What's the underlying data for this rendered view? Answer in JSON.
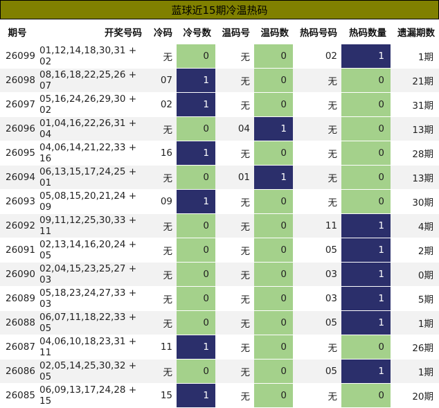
{
  "title": "蓝球近15期冷温热码",
  "headers": [
    "期号",
    "开奖号码",
    "冷码",
    "冷号数",
    "温码号",
    "温码数",
    "热码号码",
    "热码数量",
    "遗漏期数"
  ],
  "rows": [
    [
      "26099",
      "01,12,14,18,30,31 + 02",
      "无",
      "0",
      "无",
      "0",
      "02",
      "1",
      "1期"
    ],
    [
      "26098",
      "08,16,18,22,25,26 + 07",
      "07",
      "1",
      "无",
      "0",
      "无",
      "0",
      "21期"
    ],
    [
      "26097",
      "05,16,24,26,29,30 + 02",
      "02",
      "1",
      "无",
      "0",
      "无",
      "0",
      "31期"
    ],
    [
      "26096",
      "01,04,16,22,26,31 + 04",
      "无",
      "0",
      "04",
      "1",
      "无",
      "0",
      "13期"
    ],
    [
      "26095",
      "04,06,14,21,22,33 + 16",
      "16",
      "1",
      "无",
      "0",
      "无",
      "0",
      "28期"
    ],
    [
      "26094",
      "06,13,15,17,24,25 + 01",
      "无",
      "0",
      "01",
      "1",
      "无",
      "0",
      "13期"
    ],
    [
      "26093",
      "05,08,15,20,21,24 + 09",
      "09",
      "1",
      "无",
      "0",
      "无",
      "0",
      "30期"
    ],
    [
      "26092",
      "09,11,12,25,30,33 + 11",
      "无",
      "0",
      "无",
      "0",
      "11",
      "1",
      "4期"
    ],
    [
      "26091",
      "02,13,14,16,20,24 + 05",
      "无",
      "0",
      "无",
      "0",
      "05",
      "1",
      "2期"
    ],
    [
      "26090",
      "02,04,15,23,25,27 + 03",
      "无",
      "0",
      "无",
      "0",
      "03",
      "1",
      "0期"
    ],
    [
      "26089",
      "05,18,23,24,27,33 + 03",
      "无",
      "0",
      "无",
      "0",
      "03",
      "1",
      "5期"
    ],
    [
      "26088",
      "06,07,11,18,22,33 + 05",
      "无",
      "0",
      "无",
      "0",
      "05",
      "1",
      "1期"
    ],
    [
      "26087",
      "04,06,10,18,23,31 + 11",
      "11",
      "1",
      "无",
      "0",
      "无",
      "0",
      "26期"
    ],
    [
      "26086",
      "02,05,14,25,30,32 + 05",
      "无",
      "0",
      "无",
      "0",
      "05",
      "1",
      "1期"
    ],
    [
      "26085",
      "06,09,13,17,24,28 + 15",
      "15",
      "1",
      "无",
      "0",
      "无",
      "0",
      "20期"
    ]
  ]
}
